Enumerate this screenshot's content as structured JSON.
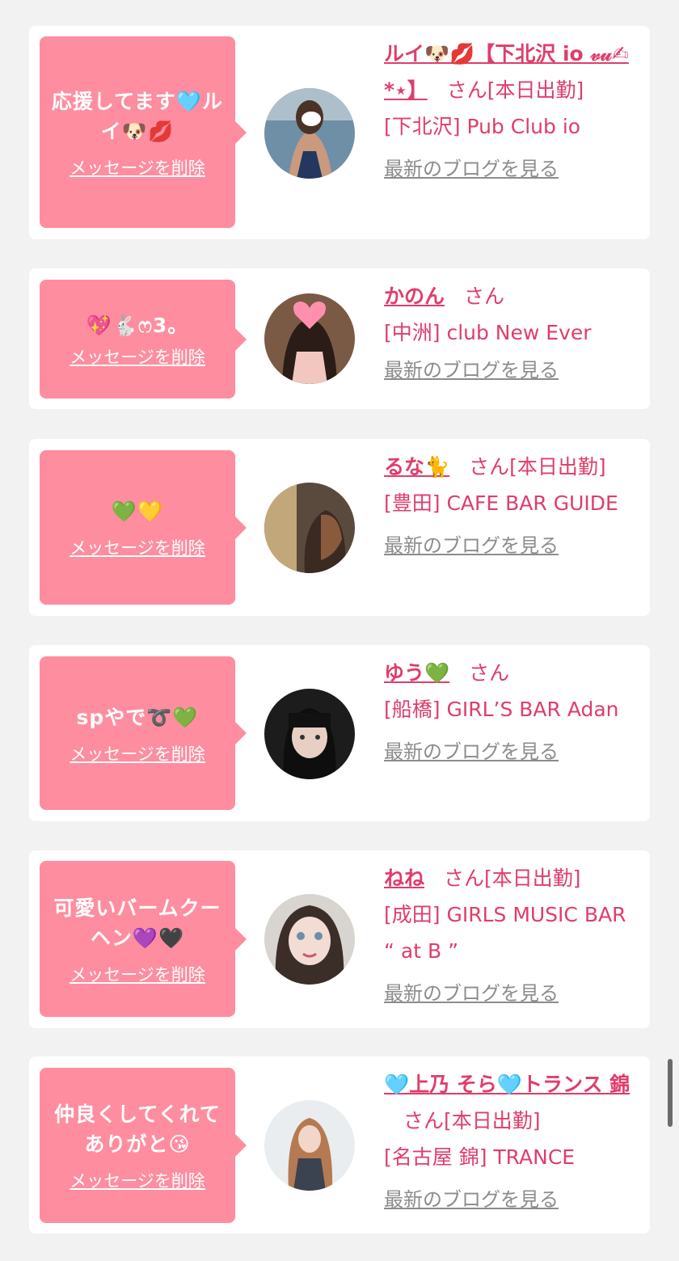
{
  "cards": [
    {
      "message": "応援してます🩵ルイ🐶💋",
      "delete_label": "メッセージを削除",
      "name": "ルイ🐶💋【下北沢 io 𝓋𝓊✍︎*⋆】",
      "honorific": "さん",
      "status": "[本日出勤]",
      "shop": "[下北沢] Pub Club io",
      "blog_label": "最新のブログを見る"
    },
    {
      "message": "💖🐇ෆ3。",
      "delete_label": "メッセージを削除",
      "name": "かのん",
      "honorific": "さん",
      "status": "",
      "shop": "[中洲] club New Ever",
      "blog_label": "最新のブログを見る"
    },
    {
      "message": "💚💛",
      "delete_label": "メッセージを削除",
      "name": "るな🐈",
      "honorific": "さん",
      "status": "[本日出勤]",
      "shop": "[豊田] CAFE BAR GUIDE",
      "blog_label": "最新のブログを見る"
    },
    {
      "message": "spやで➰💚",
      "delete_label": "メッセージを削除",
      "name": "ゆう💚",
      "honorific": "さん",
      "status": "",
      "shop": "[船橋] GIRL’S BAR Adan",
      "blog_label": "最新のブログを見る"
    },
    {
      "message": "可愛いバームクーヘン💜🖤",
      "delete_label": "メッセージを削除",
      "name": "ねね",
      "honorific": "さん",
      "status": "[本日出勤]",
      "shop": "[成田] GIRLS MUSIC BAR “ at B ”",
      "blog_label": "最新のブログを見る"
    },
    {
      "message": "仲良くしてくれてありがと😘",
      "delete_label": "メッセージを削除",
      "name": "🩵上乃 そら🩵トランス 錦",
      "honorific": "さん",
      "status": "[本日出勤]",
      "shop": "[名古屋 錦] TRANCE",
      "blog_label": "最新のブログを見る"
    }
  ],
  "colors": {
    "bubble": "#fe8d9f",
    "name": "#e03d6c",
    "link_gray": "#8c8c8c",
    "background": "#f2f2f2"
  }
}
